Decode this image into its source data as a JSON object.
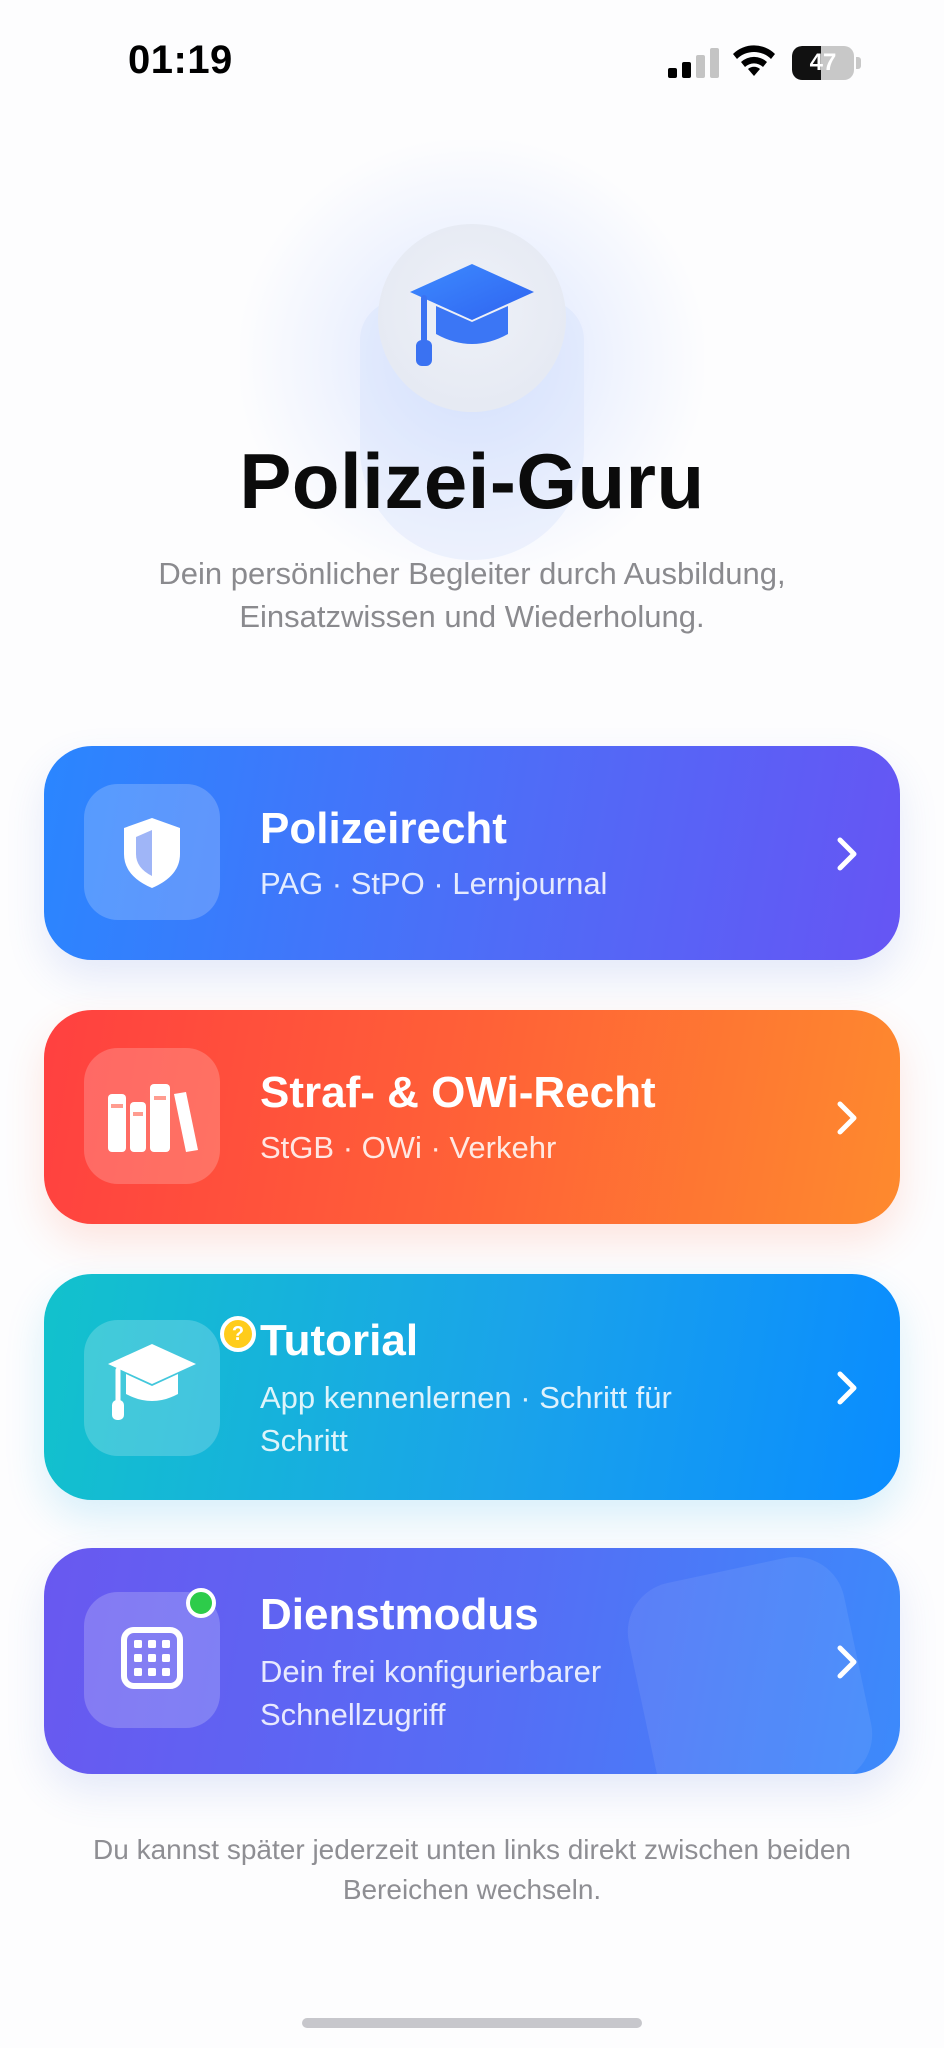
{
  "status_bar": {
    "time": "01:19",
    "battery_percent": "47",
    "battery_level": 0.47,
    "signal_bars_active": 2
  },
  "header": {
    "app_icon": "graduation-cap-icon",
    "title": "Polizei-Guru",
    "subtitle": "Dein persönlicher Begleiter durch Ausbildung, Einsatzwissen und Wiederholung."
  },
  "cards": [
    {
      "id": "polizeirecht",
      "icon": "shield-icon",
      "title": "Polizeirecht",
      "subtitle": "PAG · StPO · Lernjournal",
      "gradient": [
        "#2a86ff",
        "#6655f4"
      ]
    },
    {
      "id": "straf-owi",
      "icon": "books-icon",
      "title": "Straf- & OWi-Recht",
      "subtitle": "StGB · OWi · Verkehr",
      "gradient": [
        "#ff4040",
        "#fe8a2e"
      ]
    },
    {
      "id": "tutorial",
      "icon": "graduation-cap-icon",
      "badge": "?",
      "title": "Tutorial",
      "subtitle": "App kennenlernen · Schritt für Schritt",
      "gradient": [
        "#12c2cc",
        "#0a8cff"
      ]
    },
    {
      "id": "dienstmodus",
      "icon": "calendar-grid-icon",
      "status": "online-dot",
      "title": "Dienstmodus",
      "subtitle": "Dein frei konfigurierbarer Schnellzugriff",
      "gradient": [
        "#6958f0",
        "#3c8afb"
      ]
    }
  ],
  "footer": {
    "note": "Du kannst später jederzeit unten links direkt zwischen beiden Bereichen wechseln."
  },
  "colors": {
    "accent_blue": "#3478f6",
    "badge_yellow": "#ffcc1a",
    "online_green": "#2dcc4a"
  }
}
